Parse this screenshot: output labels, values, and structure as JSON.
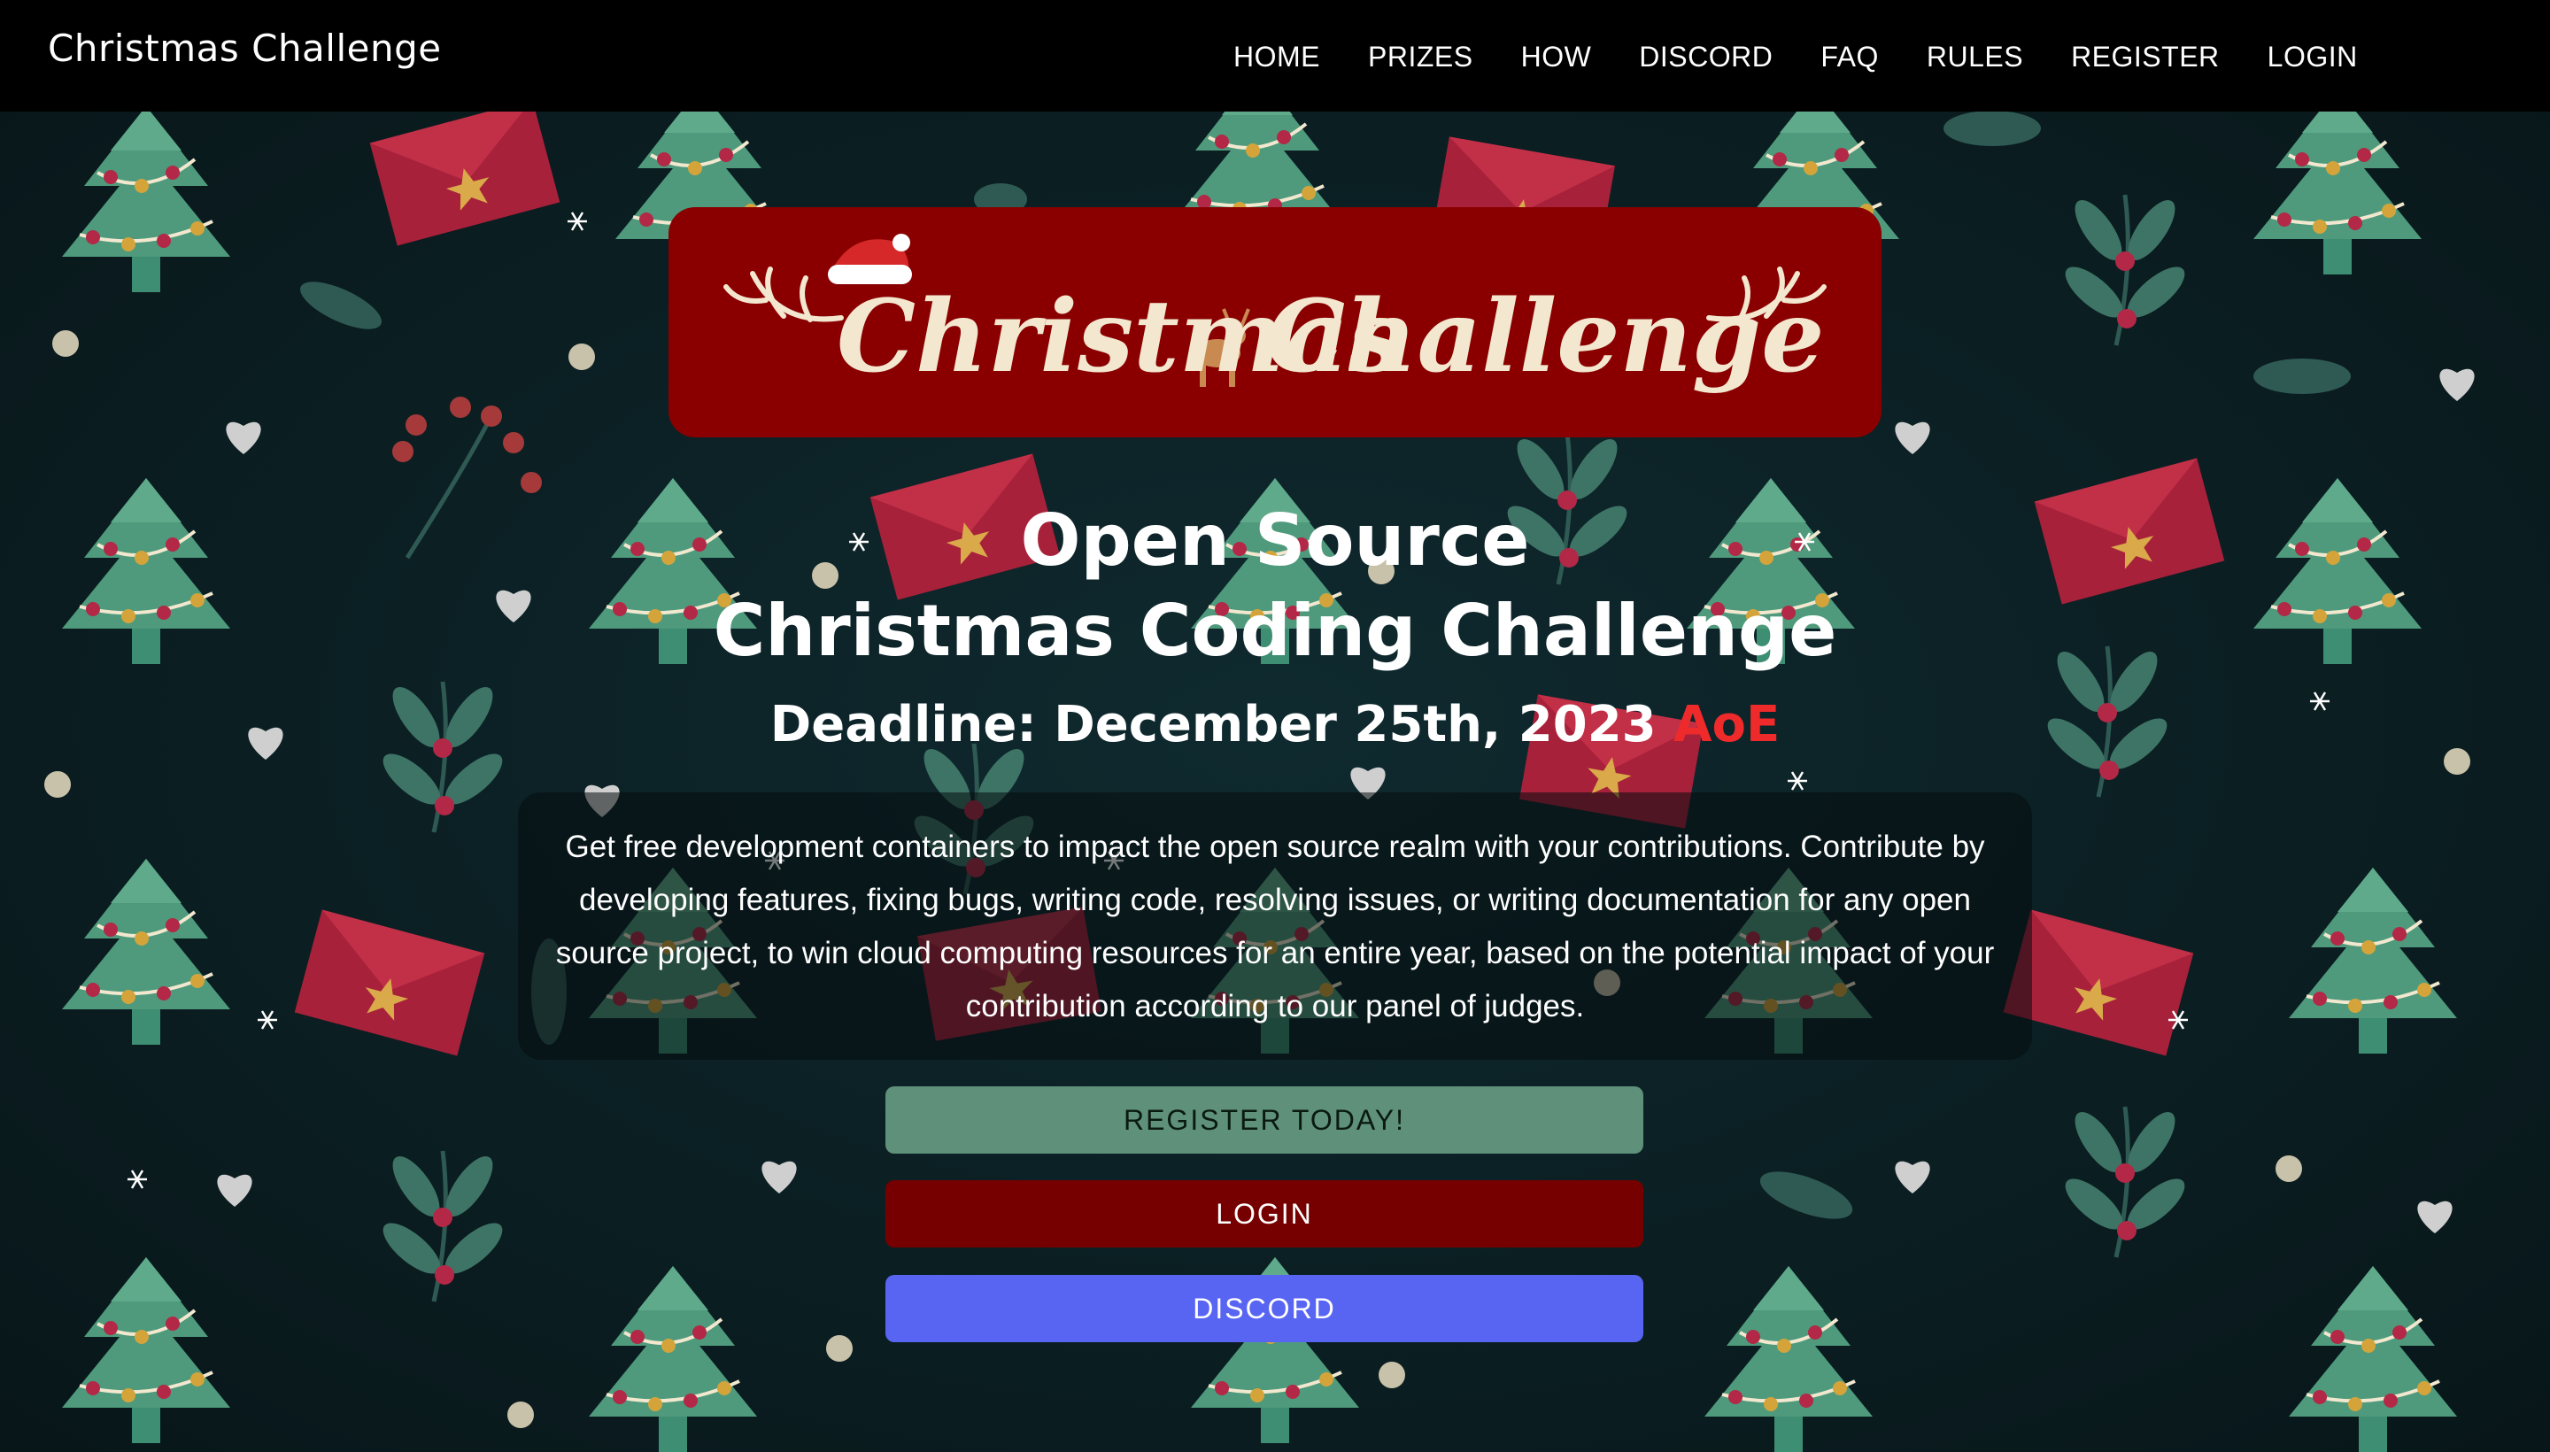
{
  "header": {
    "brand": "Christmas Challenge",
    "nav": [
      {
        "label": "HOME"
      },
      {
        "label": "PRIZES"
      },
      {
        "label": "HOW"
      },
      {
        "label": "DISCORD"
      },
      {
        "label": "FAQ"
      },
      {
        "label": "RULES"
      },
      {
        "label": "REGISTER"
      },
      {
        "label": "LOGIN"
      }
    ]
  },
  "banner": {
    "logo_text_1": "Christmas",
    "logo_text_2": "Challenge"
  },
  "hero": {
    "title_line1": "Open Source",
    "title_line2": "Christmas Coding Challenge",
    "deadline": "Deadline: December 25th, 2023",
    "deadline_suffix": "AoE",
    "description": "Get free development containers to impact the open source realm with your contributions. Contribute by developing features, fixing bugs, writing code, resolving issues, or writing documentation for any open source project, to win cloud computing resources for an entire year, based on the potential impact of your contribution according to our panel of judges."
  },
  "buttons": {
    "register": "REGISTER TODAY!",
    "login": "LOGIN",
    "discord": "DISCORD"
  },
  "colors": {
    "navbar": "#000000",
    "banner": "#8a0000",
    "accent_red": "#ef2a2a",
    "register_button": "#5f917a",
    "login_button": "#760000",
    "discord_button": "#5865f2",
    "background": "#0b1e22"
  },
  "icons": [
    "snowflake-icon",
    "christmas-tree-icon",
    "envelope-icon",
    "mistletoe-icon",
    "heart-icon",
    "santa-hat-icon",
    "reindeer-icon",
    "antler-icon"
  ]
}
